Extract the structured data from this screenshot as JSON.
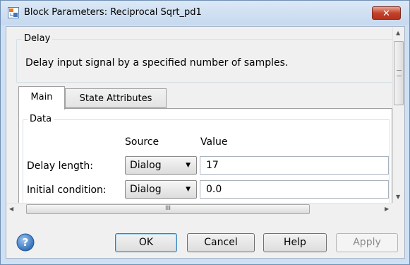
{
  "window": {
    "title": "Block Parameters: Reciprocal Sqrt_pd1",
    "close_label": "✕"
  },
  "delay_group": {
    "legend": "Delay",
    "description": "Delay input signal by a specified number of samples."
  },
  "tabs": [
    {
      "label": "Main",
      "selected": true
    },
    {
      "label": "State Attributes",
      "selected": false
    }
  ],
  "data_group": {
    "legend": "Data",
    "col_source": "Source",
    "col_value": "Value",
    "rows": [
      {
        "label": "Delay length:",
        "source": "Dialog",
        "value": "17"
      },
      {
        "label": "Initial condition:",
        "source": "Dialog",
        "value": "0.0"
      }
    ]
  },
  "buttons": {
    "ok": "OK",
    "cancel": "Cancel",
    "help": "Help",
    "apply": "Apply"
  },
  "icons": {
    "title": "simulink-block-icon",
    "help": "question-icon"
  },
  "colors": {
    "frame": "#cfe0f3",
    "close": "#c4422a",
    "help_icon": "#2f6db5"
  }
}
